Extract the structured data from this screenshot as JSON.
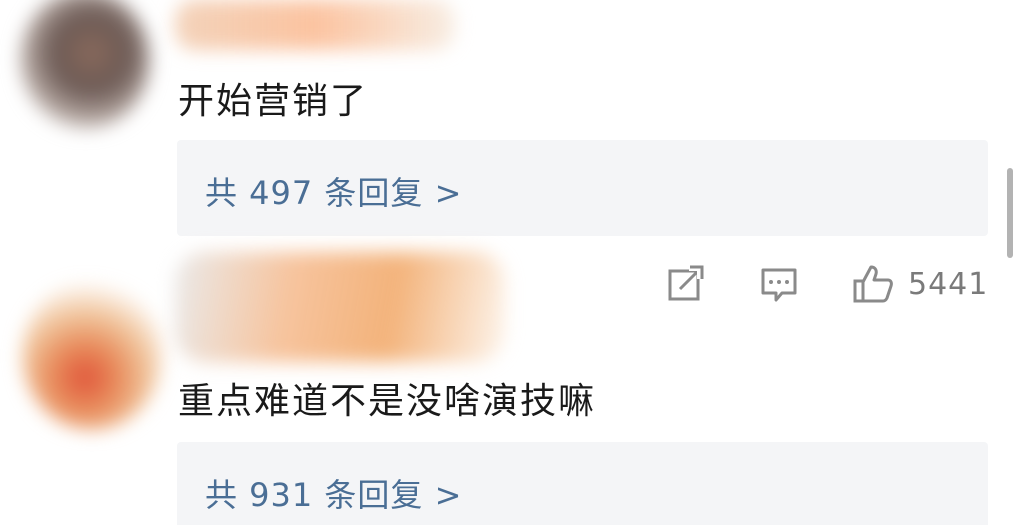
{
  "comments": [
    {
      "text": "开始营销了",
      "replies_label": "共 497 条回复 >"
    },
    {
      "text": "重点难道不是没啥演技嘛",
      "replies_label": "共 931 条回复 >",
      "actions": {
        "share_icon": "share-icon",
        "comment_icon": "comment-icon",
        "like_icon": "thumbs-up-icon",
        "like_count": "5441"
      }
    }
  ],
  "colors": {
    "link": "#4a6e95",
    "reply_bg": "#f4f5f7",
    "icon_gray": "#8a8a8a"
  }
}
